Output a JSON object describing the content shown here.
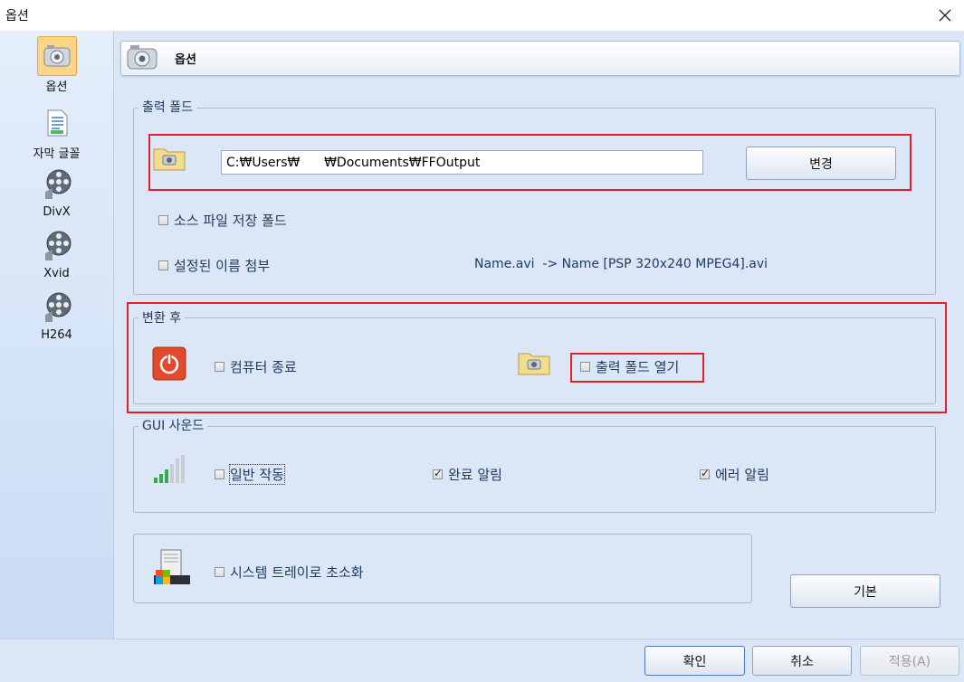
{
  "window": {
    "title": "옵션"
  },
  "sidebar": {
    "items": [
      {
        "label": "옵션",
        "icon": "options-icon",
        "selected": true
      },
      {
        "label": "자막 글꼴",
        "icon": "subtitle-font-icon",
        "selected": false
      },
      {
        "label": "DivX",
        "icon": "film-reel-icon",
        "selected": false
      },
      {
        "label": "Xvid",
        "icon": "film-reel-icon",
        "selected": false
      },
      {
        "label": "H264",
        "icon": "film-reel-icon",
        "selected": false
      }
    ]
  },
  "header": {
    "title": "옵션"
  },
  "output_folder": {
    "legend": "출력 폴드",
    "path_value": "C:₩Users₩      ₩Documents₩FFOutput",
    "change_button": "변경",
    "source_folder_label": "소스 파일 저장 폴드",
    "append_name_label": "설정된 이름 첨부",
    "name_example": "Name.avi  -> Name [PSP 320x240 MPEG4].avi"
  },
  "after_convert": {
    "legend": "변환 후",
    "shutdown_label": "컴퓨터 종료",
    "open_folder_label": "출력 폴드 열기"
  },
  "gui_sound": {
    "legend": "GUI 사운드",
    "normal_label": "일반 작동",
    "complete_label": "완료 알림",
    "complete_checked": true,
    "error_label": "에러 알림",
    "error_checked": true
  },
  "tray": {
    "minimize_label": "시스템 트레이로 초소화"
  },
  "buttons": {
    "default": "기본",
    "ok": "확인",
    "cancel": "취소",
    "apply": "적용(A)"
  },
  "colors": {
    "accent": "#e0202a",
    "panel": "#dbe7f7",
    "text_blue": "#1e3a5f"
  }
}
